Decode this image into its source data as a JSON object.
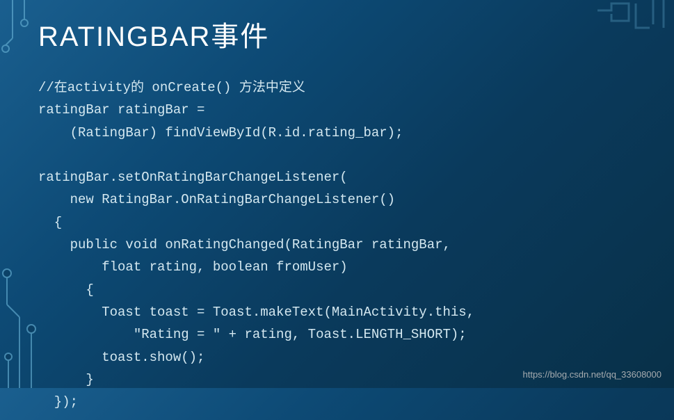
{
  "slide": {
    "title": "RATINGBAR事件",
    "code": "//在activity的 onCreate() 方法中定义\nratingBar ratingBar =\n    (RatingBar) findViewById(R.id.rating_bar);\n\nratingBar.setOnRatingBarChangeListener(\n    new RatingBar.OnRatingBarChangeListener()\n  {\n    public void onRatingChanged(RatingBar ratingBar,\n        float rating, boolean fromUser)\n      {\n        Toast toast = Toast.makeText(MainActivity.this,\n            \"Rating = \" + rating, Toast.LENGTH_SHORT);\n        toast.show();\n      }\n  });"
  },
  "watermark": "https://blog.csdn.net/qq_33608000"
}
